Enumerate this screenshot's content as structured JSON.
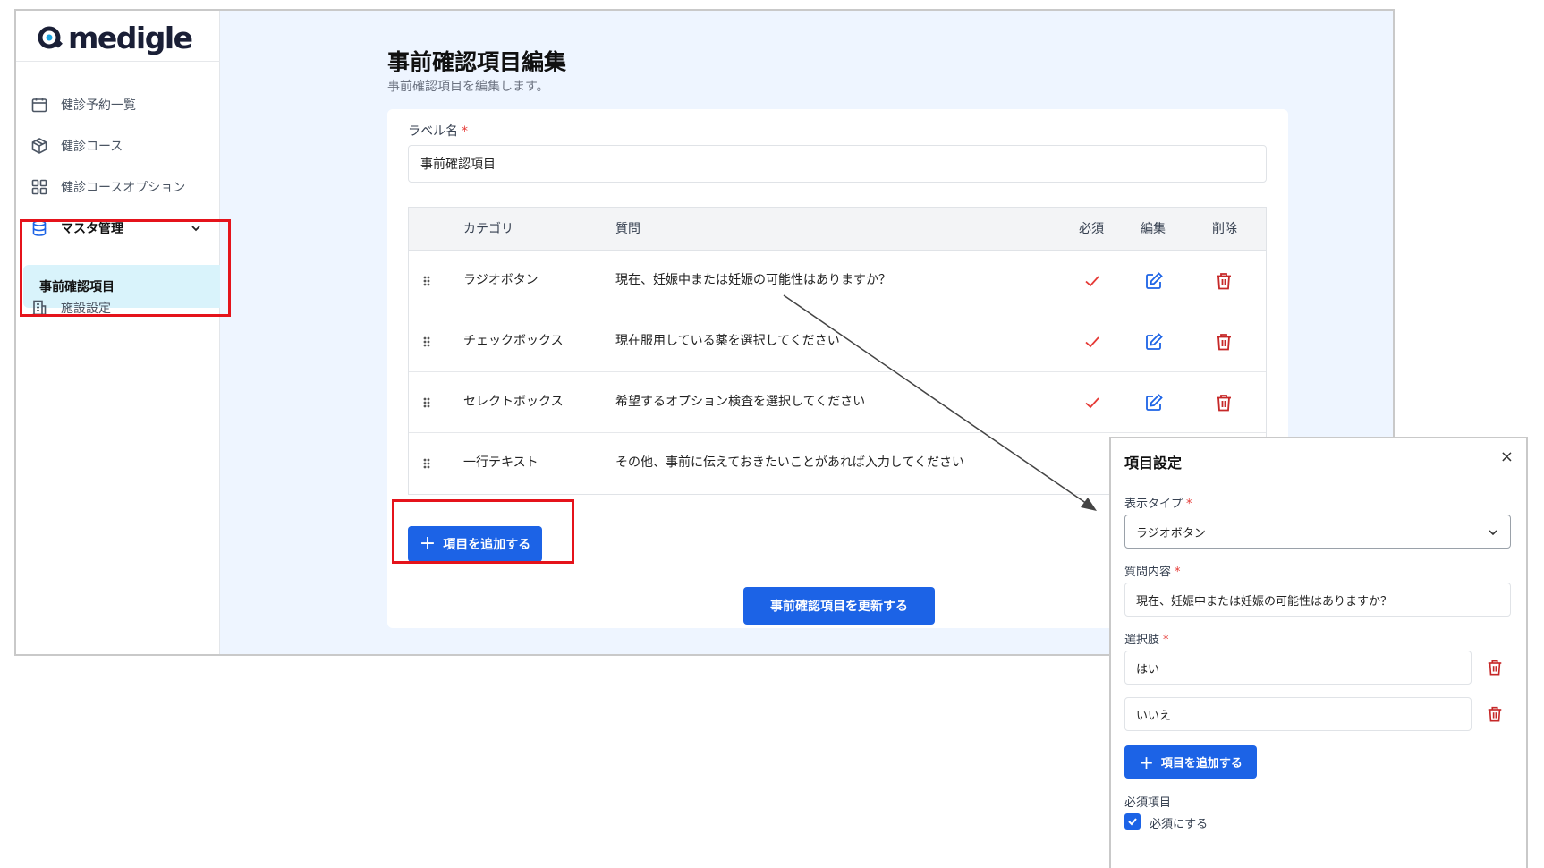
{
  "brand": {
    "name": "medigle"
  },
  "sidebar": {
    "items": [
      {
        "label": "健診予約一覧",
        "icon": "calendar-icon"
      },
      {
        "label": "健診コース",
        "icon": "box-icon"
      },
      {
        "label": "健診コースオプション",
        "icon": "grid-icon"
      },
      {
        "label": "マスタ管理",
        "icon": "database-icon"
      },
      {
        "label": "施設設定",
        "icon": "building-icon"
      }
    ],
    "sub_item": {
      "label": "事前確認項目"
    }
  },
  "page": {
    "title": "事前確認項目編集",
    "subtitle": "事前確認項目を編集します。"
  },
  "form": {
    "label_name": "ラベル名",
    "required_mark": "*",
    "label_value": "事前確認項目"
  },
  "table": {
    "headers": {
      "category": "カテゴリ",
      "question": "質問",
      "required": "必須",
      "edit": "編集",
      "delete": "削除"
    },
    "rows": [
      {
        "category": "ラジオボタン",
        "question": "現在、妊娠中または妊娠の可能性はありますか？",
        "required": true
      },
      {
        "category": "チェックボックス",
        "question": "現在服用している薬を選択してください",
        "required": true
      },
      {
        "category": "セレクトボックス",
        "question": "希望するオプション検査を選択してください",
        "required": true
      },
      {
        "category": "一行テキスト",
        "question": "その他、事前に伝えておきたいことがあれば入力してください",
        "required": false
      }
    ]
  },
  "buttons": {
    "add_item": "項目を追加する",
    "update": "事前確認項目を更新する"
  },
  "dialog": {
    "title": "項目設定",
    "close": "×",
    "display_type_label": "表示タイプ",
    "display_type_value": "ラジオボタン",
    "question_label": "質問内容",
    "question_value": "現在、妊娠中または妊娠の可能性はありますか？",
    "options_label": "選択肢",
    "options": [
      "はい",
      "いいえ"
    ],
    "add_option": "項目を追加する",
    "required_label": "必須項目",
    "required_checkbox": "必須にする",
    "required_checked": true
  },
  "colors": {
    "primary": "#1c63e6",
    "highlight": "#e5131b",
    "check": "#e53935",
    "delete": "#c62828",
    "main_bg": "#eef5ff"
  }
}
